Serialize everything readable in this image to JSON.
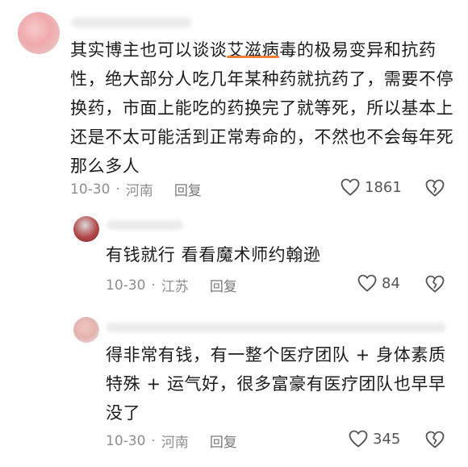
{
  "comments": [
    {
      "text_before": "其实博主也可以谈谈",
      "highlight": "艾滋病",
      "text_after": "毒的极易变异和抗药性，绝大部分人吃几年某种药就抗药了，需要不停换药，市面上能吃的药换完了就等死，所以基本上还是不太可能活到正常寿命的，不然也不会每年死那么多人",
      "date": "10-30",
      "location": "河南",
      "reply_label": "回复",
      "likes": "1861"
    },
    {
      "text": "有钱就行 看看魔术师约翰逊",
      "date": "10-30",
      "location": "江苏",
      "reply_label": "回复",
      "likes": "84"
    },
    {
      "text": "得非常有钱，有一整个医疗团队 + 身体素质特殊 + 运气好，很多富豪有医疗团队也早早没了",
      "date": "10-30",
      "location": "河南",
      "reply_label": "回复",
      "likes": "345"
    }
  ],
  "icons": {
    "like": "heart-outline-icon",
    "dislike": "broken-heart-icon"
  },
  "colors": {
    "highlight_underline": "#f07f3c",
    "meta_text": "#8e8e8e"
  }
}
